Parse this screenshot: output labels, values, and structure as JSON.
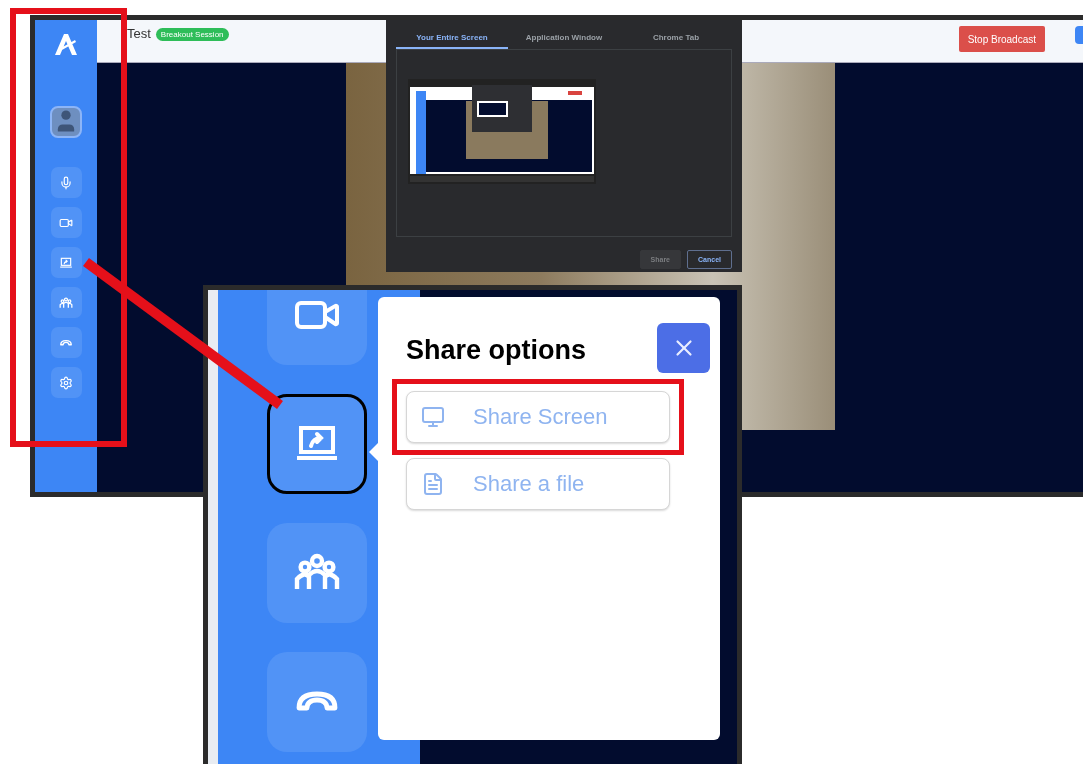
{
  "top_bar": {
    "title": "Test",
    "badge": "Breakout Session",
    "stop_button": "Stop Broadcast"
  },
  "sidebar": {
    "highlighted": true,
    "items": [
      {
        "kind": "avatar"
      },
      {
        "kind": "mic"
      },
      {
        "kind": "camera"
      },
      {
        "kind": "share"
      },
      {
        "kind": "people"
      },
      {
        "kind": "hangup"
      },
      {
        "kind": "settings"
      }
    ]
  },
  "share_dialog": {
    "tabs": [
      {
        "label": "Your Entire Screen",
        "selected": true
      },
      {
        "label": "Application Window",
        "selected": false
      },
      {
        "label": "Chrome Tab",
        "selected": false
      }
    ],
    "buttons": [
      {
        "label": "Share",
        "disabled": true
      },
      {
        "label": "Cancel",
        "disabled": false
      }
    ]
  },
  "inset": {
    "callout_pointer": true,
    "sidebar_items": [
      {
        "kind": "camera",
        "selected": false
      },
      {
        "kind": "share",
        "selected": true
      },
      {
        "kind": "people",
        "selected": false
      },
      {
        "kind": "hangup",
        "selected": false
      }
    ],
    "popover": {
      "title": "Share options",
      "options": [
        {
          "kind": "screen",
          "label": "Share Screen",
          "highlighted": true
        },
        {
          "kind": "file",
          "label": "Share a file",
          "highlighted": false
        }
      ]
    }
  }
}
